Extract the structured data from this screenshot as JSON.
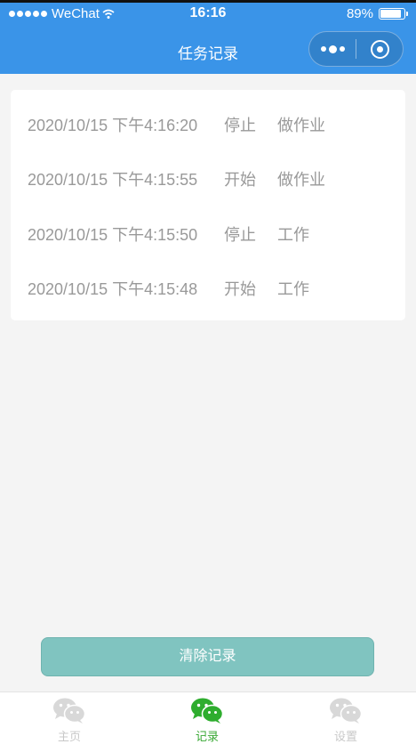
{
  "status_bar": {
    "carrier": "WeChat",
    "time": "16:16",
    "battery": "89%",
    "battery_level": 0.89
  },
  "nav": {
    "title": "任务记录"
  },
  "records": [
    {
      "time": "2020/10/15 下午4:16:20",
      "action": "停止",
      "task": "做作业"
    },
    {
      "time": "2020/10/15 下午4:15:55",
      "action": "开始",
      "task": "做作业"
    },
    {
      "time": "2020/10/15 下午4:15:50",
      "action": "停止",
      "task": "工作"
    },
    {
      "time": "2020/10/15 下午4:15:48",
      "action": "开始",
      "task": "工作"
    }
  ],
  "clear_button_label": "清除记录",
  "tabs": [
    {
      "label": "主页",
      "icon": "wechat-icon",
      "active": false
    },
    {
      "label": "记录",
      "icon": "wechat-icon",
      "active": true
    },
    {
      "label": "设置",
      "icon": "wechat-icon",
      "active": false
    }
  ],
  "colors": {
    "header": "#3a94e8",
    "button": "#80c4c0",
    "tab_active": "#3aa935",
    "tab_inactive": "#c8c8c8"
  }
}
